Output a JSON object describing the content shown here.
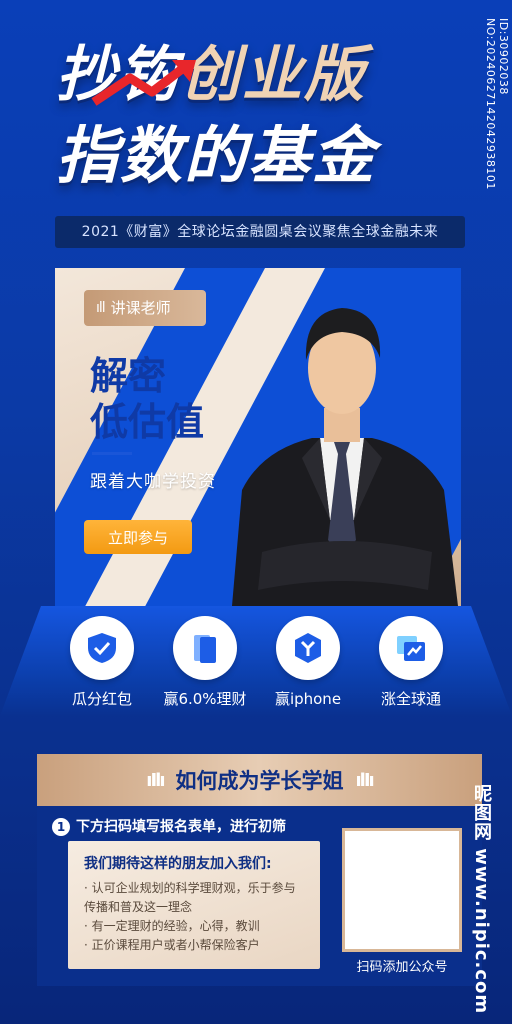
{
  "header": {
    "title_line1_white": "抄",
    "title_line1_mid": "钩",
    "title_line1_gold": "创业版",
    "title_line2": "指数的基金",
    "subtitle": "2021《财富》全球论坛金融圆桌会议聚焦全球金融未来",
    "side_code": "ID:30902038 NO:20240627142042938101"
  },
  "hero": {
    "tag": "讲课老师",
    "headline1": "解密",
    "headline2": "低估值",
    "tagline": "跟着大咖学投资",
    "cta": "立即参与"
  },
  "features": [
    {
      "label": "瓜分红包",
      "icon": "shield-check-icon"
    },
    {
      "label": "赢6.0%理财",
      "icon": "cards-icon"
    },
    {
      "label": "赢iphone",
      "icon": "hexagon-y-icon"
    },
    {
      "label": "涨全球通",
      "icon": "chart-window-icon"
    }
  ],
  "panel": {
    "title": "如何成为学长学姐",
    "step_number": "1",
    "step_text": "下方扫码填写报名表单，进行初筛",
    "requirements_title": "我们期待这样的朋友加入我们:",
    "requirements": [
      "· 认可企业规划的科学理财观，乐于参与",
      "   传播和普及这一理念",
      "· 有一定理财的经验，心得，教训",
      "· 正价课程用户或者小帮保险客户"
    ],
    "qr_label": "扫码添加公众号"
  },
  "watermark": "昵图网 www.nipic.com",
  "colors": {
    "primary_blue": "#0a3fb8",
    "gold": "#d9b89a",
    "cta_orange": "#f39a12"
  }
}
